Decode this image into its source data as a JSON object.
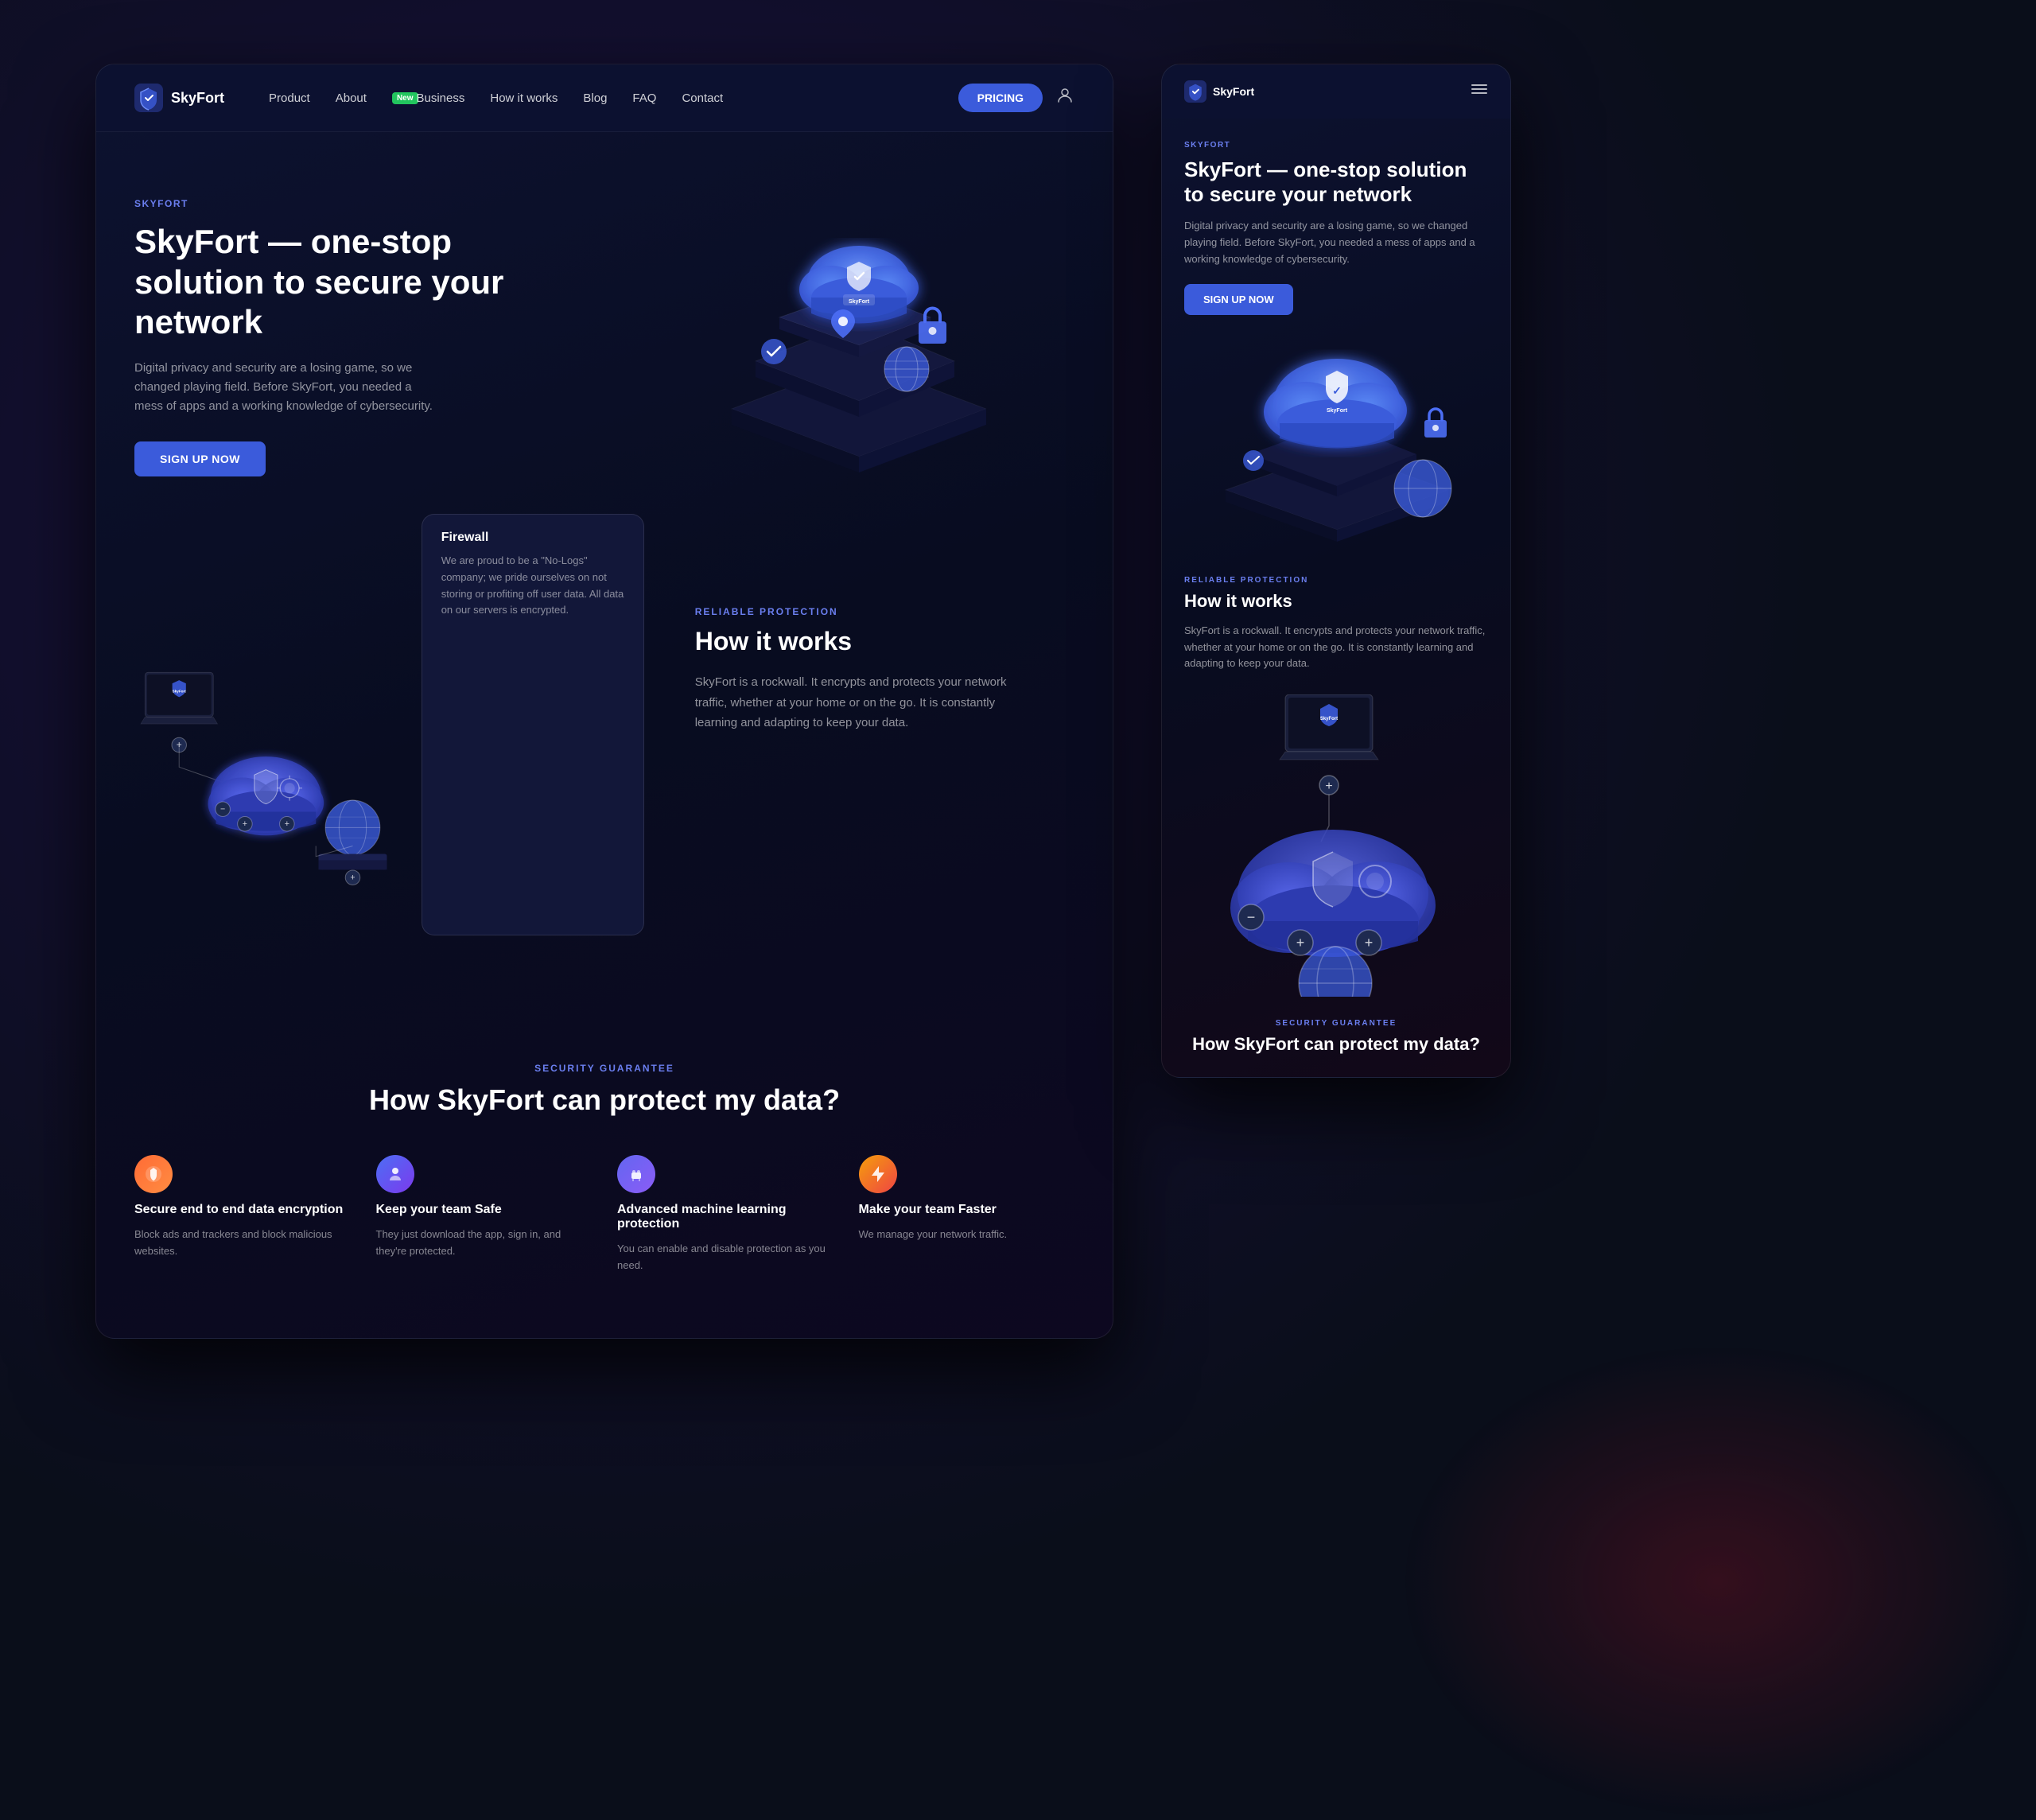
{
  "brand": {
    "name": "SkyFort",
    "tag": "SKYFORT"
  },
  "nav": {
    "links": [
      {
        "label": "Product",
        "id": "product"
      },
      {
        "label": "About",
        "id": "about"
      },
      {
        "label": "Business",
        "id": "business",
        "badge": "New"
      },
      {
        "label": "How it works",
        "id": "how-it-works"
      },
      {
        "label": "Blog",
        "id": "blog"
      },
      {
        "label": "FAQ",
        "id": "faq"
      },
      {
        "label": "Contact",
        "id": "contact"
      }
    ],
    "pricing_label": "PRICING"
  },
  "hero": {
    "brand_tag": "SKYFORT",
    "title": "SkyFort — one-stop solution to secure your network",
    "description": "Digital privacy and security are a losing game, so we changed playing field. Before SkyFort, you needed a mess of apps and a working knowledge of cybersecurity.",
    "cta_label": "SIGN UP NOW"
  },
  "how_it_works": {
    "section_tag": "RELIABLE PROTECTION",
    "title": "How it works",
    "description": "SkyFort is a rockwall. It encrypts and protects your network traffic, whether at your home or on the go. It is constantly learning and adapting to keep your data.",
    "firewall": {
      "title": "Firewall",
      "description": "We are proud to be a \"No-Logs\" company; we pride ourselves on not storing or profiting off user data. All data on our servers is encrypted."
    }
  },
  "security": {
    "section_tag": "SECURITY GUARANTEE",
    "title": "How SkyFort can protect my data?",
    "features": [
      {
        "icon_type": "orange",
        "icon": "🔒",
        "title": "Secure end to end data encryption",
        "description": "Block ads and trackers and block malicious websites."
      },
      {
        "icon_type": "blue",
        "icon": "🔵",
        "title": "Keep your team Safe",
        "description": "They just download the app, sign in, and they're protected."
      },
      {
        "icon_type": "indigo",
        "icon": "🤖",
        "title": "Advanced machine learning protection",
        "description": "You can enable and disable protection as you need."
      },
      {
        "icon_type": "amber",
        "icon": "⚡",
        "title": "Make your team Faster",
        "description": "We manage your network traffic."
      }
    ]
  },
  "mobile": {
    "hero_title": "SkyFort — one-stop solution to secure your network",
    "hero_desc": "Digital privacy and security are a losing game, so we changed playing field. Before SkyFort, you needed a mess of apps and a working knowledge of cybersecurity.",
    "cta_label": "SIGN UP NOW",
    "how_title": "How it works",
    "how_desc": "SkyFort is a rockwall. It encrypts and protects your network traffic, whether at your home or on the go. It is constantly learning and adapting to keep your data.",
    "security_title": "How SkyFort can protect my data?"
  }
}
